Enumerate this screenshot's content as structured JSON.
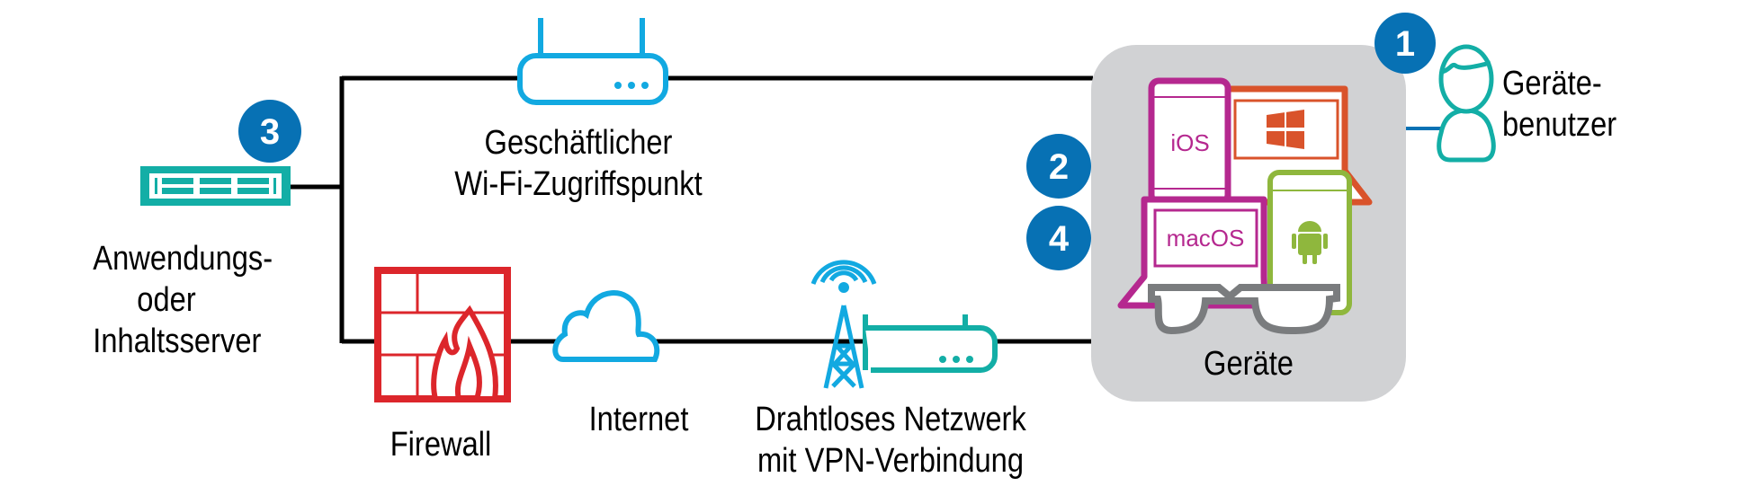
{
  "nodes": {
    "server": {
      "label": [
        "Anwendungs-",
        "oder",
        "Inhaltsserver"
      ],
      "badge": "3"
    },
    "wifi_ap": {
      "label": [
        "Geschäftlicher",
        "Wi-Fi-Zugriffspunkt"
      ]
    },
    "firewall": {
      "label": "Firewall"
    },
    "internet": {
      "label": "Internet"
    },
    "wireless_vpn": {
      "label": [
        "Drahtloses Netzwerk",
        "mit VPN-Verbindung"
      ]
    },
    "devices": {
      "label": "Geräte",
      "badges": [
        "2",
        "4"
      ],
      "device_labels": {
        "ios": "iOS",
        "macos": "macOS"
      }
    },
    "user": {
      "label": [
        "Geräte-",
        "benutzer"
      ],
      "badge": "1"
    }
  },
  "icons": [
    "server-icon",
    "router-icon",
    "firewall-icon",
    "cloud-icon",
    "cell-tower-icon",
    "router-icon",
    "ios-phone-icon",
    "windows-laptop-icon",
    "macos-laptop-icon",
    "android-phone-icon",
    "smart-glasses-icon",
    "user-icon"
  ],
  "colors": {
    "badge": "#0771b4",
    "line": "#000000",
    "wifi": "#12a9e1",
    "teal": "#13aea6",
    "firewall": "#dc262b",
    "ios": "#b5288f",
    "windows": "#d9532b",
    "android": "#8fb73d",
    "glasses": "#7a7c7e",
    "devices_bg": "#d1d2d4",
    "user_link": "#0771b4"
  }
}
